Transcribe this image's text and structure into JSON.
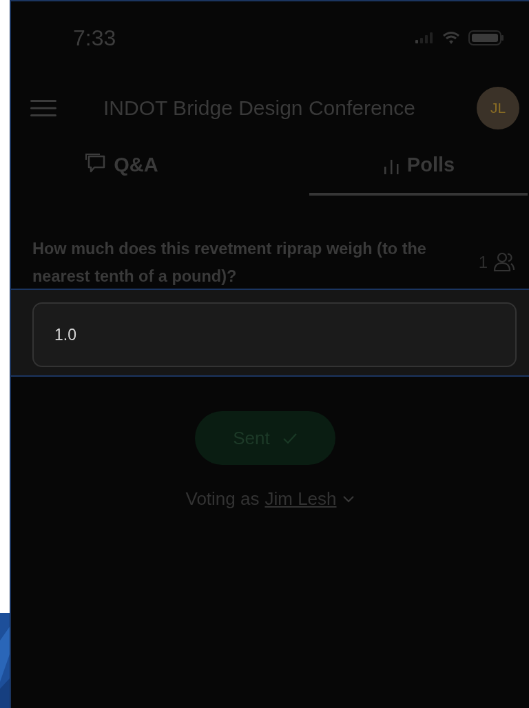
{
  "status_bar": {
    "time": "7:33"
  },
  "header": {
    "title": "INDOT Bridge Design Conference",
    "avatar": "JL"
  },
  "tabs": [
    {
      "label": "Q&A",
      "kind": "chat",
      "selected": false
    },
    {
      "label": "Polls",
      "kind": "chart",
      "selected": true
    }
  ],
  "poll": {
    "question": "How much does this revetment riprap weigh (to the nearest tenth of a pound)?",
    "respondents": "1"
  },
  "answer": {
    "value": "1.0"
  },
  "submit": {
    "label": "Sent"
  },
  "voting": {
    "prefix": "Voting as",
    "name": "Jim Lesh"
  }
}
